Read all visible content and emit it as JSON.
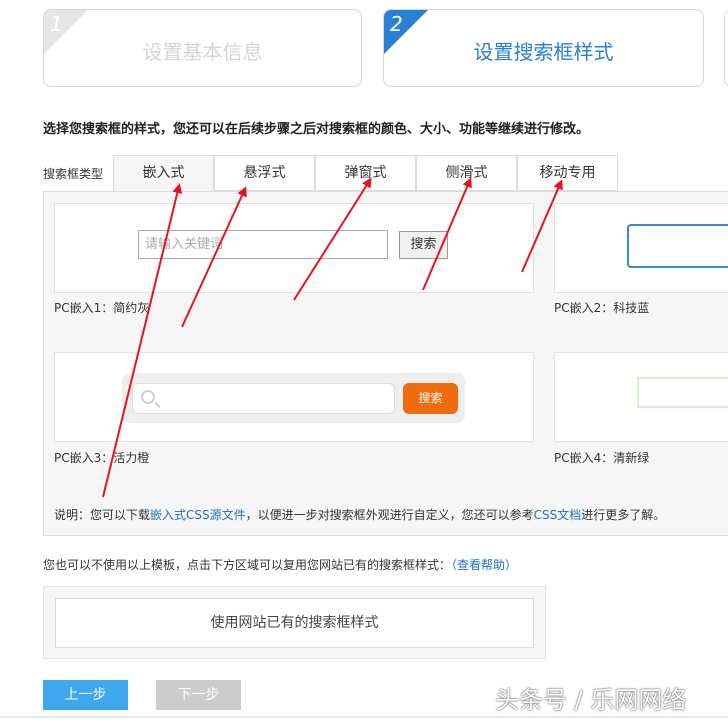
{
  "steps": [
    {
      "number": "1",
      "title": "设置基本信息"
    },
    {
      "number": "2",
      "title": "设置搜索框样式"
    }
  ],
  "instruction": "选择您搜索框的样式，您还可以在后续步骤之后对搜索框的颜色、大小、功能等继续进行修改。",
  "search_type_label": "搜索框类型",
  "tabs": [
    {
      "label": "嵌入式",
      "active": true
    },
    {
      "label": "悬浮式",
      "active": false
    },
    {
      "label": "弹窗式",
      "active": false
    },
    {
      "label": "侧滑式",
      "active": false
    },
    {
      "label": "移动专用",
      "active": false
    }
  ],
  "templates": [
    {
      "caption": "PC嵌入1：简约灰",
      "placeholder": "请输入关键词",
      "button": "搜索"
    },
    {
      "caption": "PC嵌入2：科技蓝"
    },
    {
      "caption": "PC嵌入3：活力橙",
      "button": "搜索"
    },
    {
      "caption": "PC嵌入4：清新绿"
    }
  ],
  "note": {
    "prefix": "说明：您可以下载",
    "link1": "嵌入式CSS源文件",
    "middle": "，以便进一步对搜索框外观进行自定义，您还可以参考",
    "link2": "CSS文档",
    "suffix": "进行更多了解。"
  },
  "alt": {
    "text": "您也可以不使用以上模板，点击下方区域可以复用您网站已有的搜索框样式：",
    "help_link": "（查看帮助）"
  },
  "use_existing_label": "使用网站已有的搜索框样式",
  "buttons": {
    "prev": "上一步",
    "next": "下一步"
  },
  "watermark": "头条号 / 乐网网络",
  "colors": {
    "accent": "#2a7fd6",
    "prev_button": "#3ea7ee",
    "disabled": "#cccccc",
    "orange": "#f06a0e",
    "arrow": "#e8141a"
  }
}
